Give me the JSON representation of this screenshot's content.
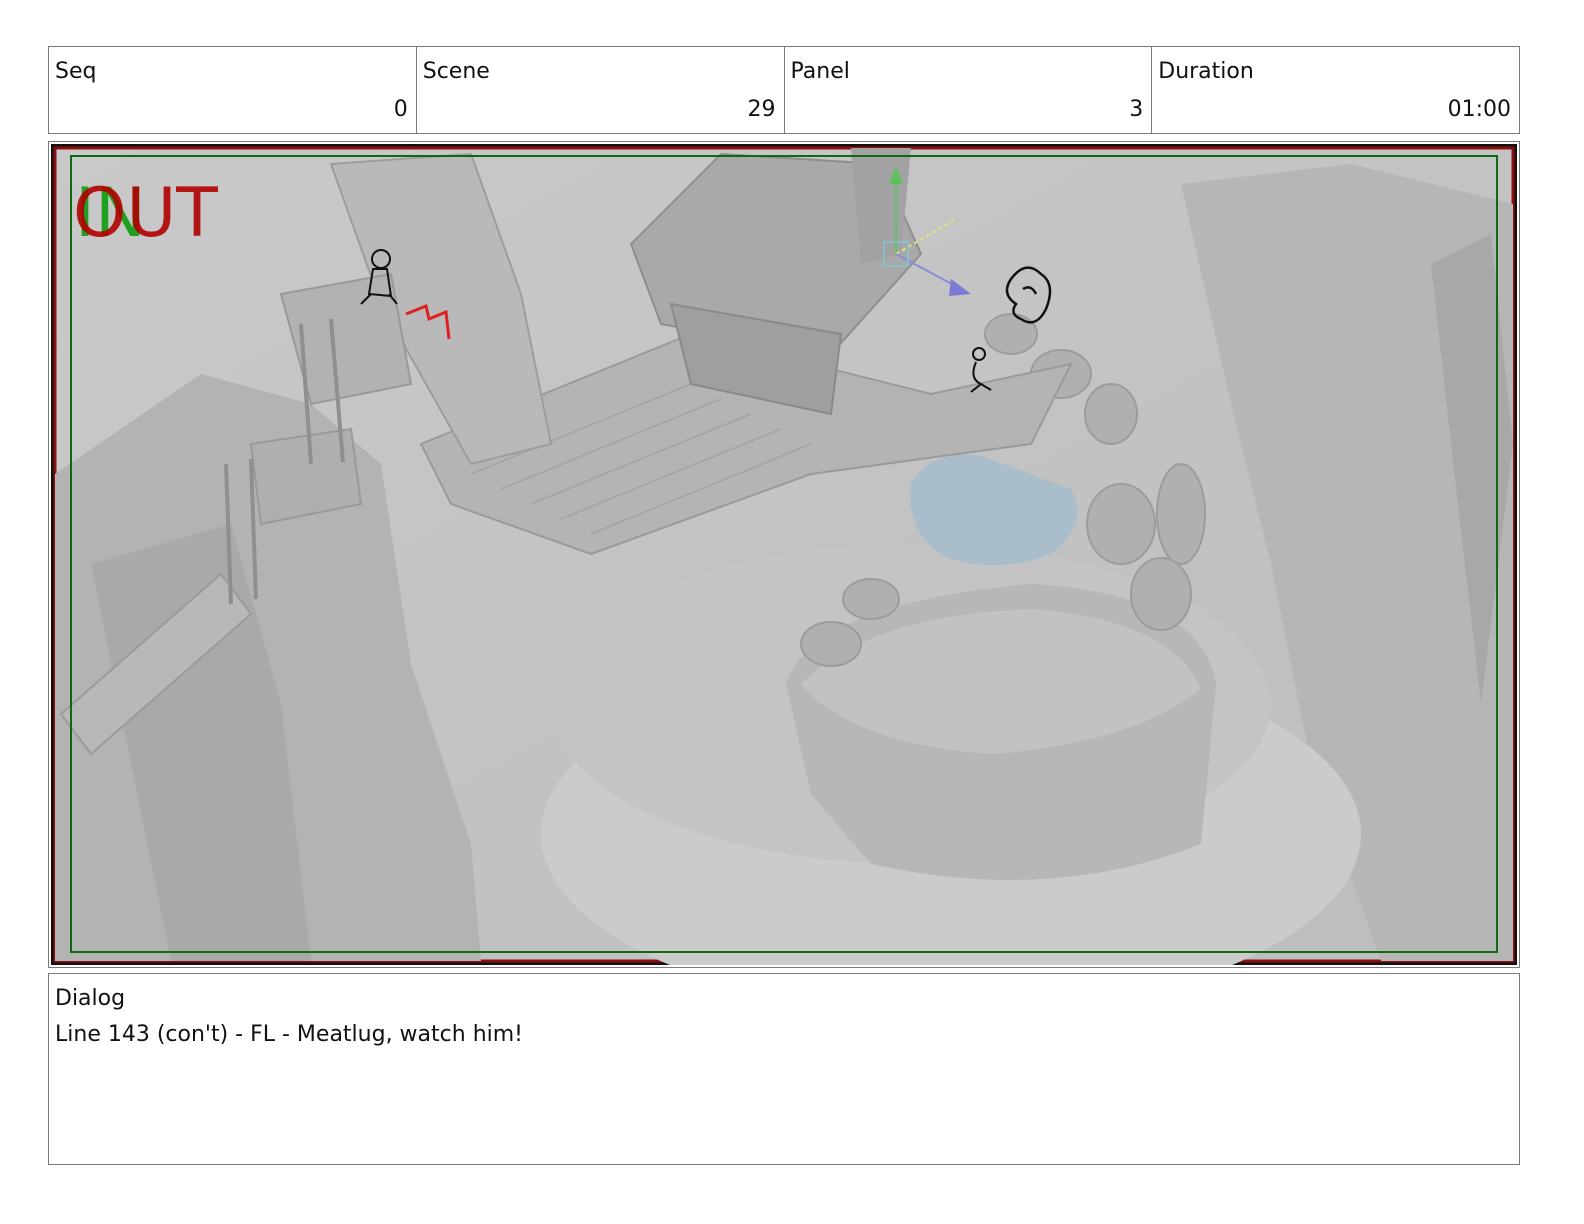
{
  "header": {
    "seq": {
      "label": "Seq",
      "value": "0"
    },
    "scene": {
      "label": "Scene",
      "value": "29"
    },
    "panel": {
      "label": "Panel",
      "value": "3"
    },
    "duration": {
      "label": "Duration",
      "value": "01:00"
    }
  },
  "panel_image": {
    "overlay_in": "IN",
    "overlay_out": "OUT",
    "colors": {
      "in": "#1fa11f",
      "out": "#b00000",
      "safe_frame": "#0f6a0f",
      "water": "#a9bdca"
    }
  },
  "dialog": {
    "label": "Dialog",
    "text": "Line 143 (con't) - FL - Meatlug, watch him!"
  }
}
